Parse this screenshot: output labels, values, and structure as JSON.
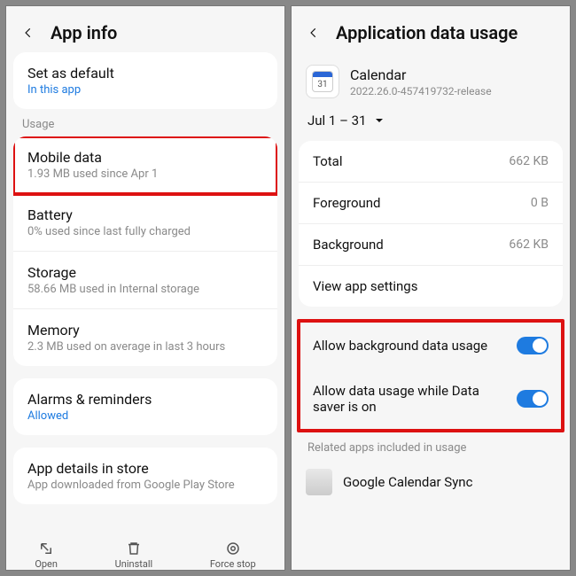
{
  "left": {
    "title": "App info",
    "set_default": {
      "title": "Set as default",
      "sub": "In this app"
    },
    "usage_label": "Usage",
    "mobile_data": {
      "title": "Mobile data",
      "sub": "1.93 MB used since Apr 1"
    },
    "battery": {
      "title": "Battery",
      "sub": "0% used since last fully charged"
    },
    "storage": {
      "title": "Storage",
      "sub": "58.66 MB used in Internal storage"
    },
    "memory": {
      "title": "Memory",
      "sub": "2.3 MB used on average in last 3 hours"
    },
    "alarms": {
      "title": "Alarms & reminders",
      "sub": "Allowed"
    },
    "app_details": {
      "title": "App details in store",
      "sub": "App downloaded from Google Play Store"
    },
    "dock": {
      "open": "Open",
      "uninstall": "Uninstall",
      "force_stop": "Force stop"
    }
  },
  "right": {
    "title": "Application data usage",
    "app": {
      "name": "Calendar",
      "version": "2022.26.0-457419732-release",
      "icon_num": "31"
    },
    "date_range": "Jul 1 – 31",
    "total": {
      "label": "Total",
      "value": "662 KB"
    },
    "foreground": {
      "label": "Foreground",
      "value": "0 B"
    },
    "background": {
      "label": "Background",
      "value": "662 KB"
    },
    "view_settings": "View app settings",
    "allow_bg": "Allow background data usage",
    "allow_ds": "Allow data usage while Data saver is on",
    "related_label": "Related apps included in usage",
    "related_app": "Google Calendar Sync"
  }
}
